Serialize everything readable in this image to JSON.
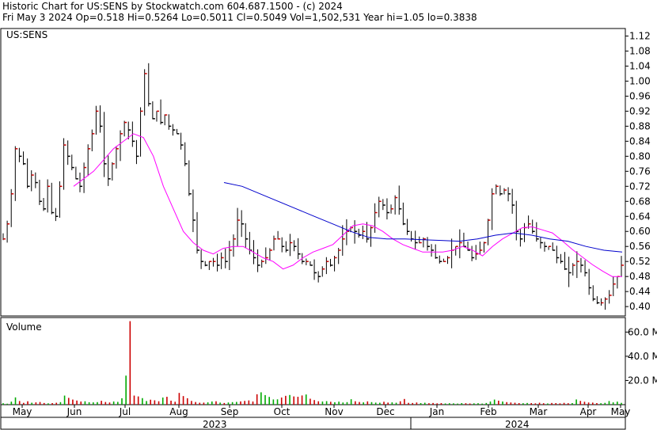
{
  "header": {
    "line1": "Historic Chart for US:SENS by Stockwatch.com 604.687.1500 - (c) 2024",
    "line2": "Fri May  3 2024   Op=0.518   Hi=0.5264   Lo=0.5011   Cl=0.5049   Vol=1,502,531   Year hi=1.05   lo=0.3838"
  },
  "chart_data": [
    {
      "type": "line",
      "title": "US:SENS",
      "series": [
        {
          "name": "",
          "values": [
            0.58,
            0.62,
            0.7,
            0.82,
            0.8,
            0.78,
            0.72,
            0.75,
            0.73,
            0.68,
            0.66,
            0.72,
            0.65,
            0.64,
            0.72,
            0.83,
            0.8,
            0.77,
            0.74,
            0.72,
            0.77,
            0.82,
            0.86,
            0.92,
            0.88,
            0.78,
            0.74,
            0.78,
            0.82,
            0.86,
            0.89,
            0.87,
            0.84,
            0.8,
            0.92,
            1.02,
            0.94,
            0.9,
            0.92,
            0.89,
            0.91,
            0.88,
            0.87,
            0.86,
            0.83,
            0.78,
            0.7,
            0.63,
            0.55,
            0.52,
            0.51,
            0.52,
            0.52,
            0.51,
            0.53,
            0.52,
            0.55,
            0.58,
            0.63,
            0.62,
            0.58,
            0.55,
            0.53,
            0.51,
            0.52,
            0.53,
            0.55,
            0.58,
            0.58,
            0.56,
            0.55,
            0.57,
            0.56,
            0.54,
            0.52,
            0.52,
            0.51,
            0.49,
            0.48,
            0.5,
            0.52,
            0.51,
            0.53,
            0.55,
            0.58,
            0.6,
            0.61,
            0.6,
            0.59,
            0.6,
            0.58,
            0.61,
            0.65,
            0.68,
            0.67,
            0.65,
            0.66,
            0.69,
            0.66,
            0.62,
            0.6,
            0.58,
            0.57,
            0.57,
            0.58,
            0.56,
            0.55,
            0.53,
            0.52,
            0.52,
            0.53,
            0.55,
            0.56,
            0.57,
            0.56,
            0.55,
            0.53,
            0.54,
            0.55,
            0.57,
            0.63,
            0.7,
            0.72,
            0.7,
            0.71,
            0.7,
            0.67,
            0.6,
            0.58,
            0.61,
            0.62,
            0.6,
            0.58,
            0.57,
            0.56,
            0.56,
            0.55,
            0.53,
            0.52,
            0.5,
            0.49,
            0.51,
            0.52,
            0.51,
            0.49,
            0.45,
            0.42,
            0.41,
            0.41,
            0.42,
            0.43,
            0.46,
            0.48,
            0.51
          ]
        },
        {
          "name": "",
          "values": [
            0.72,
            0.74,
            0.76,
            0.79,
            0.82,
            0.84,
            0.86,
            0.85,
            0.8,
            0.72,
            0.66,
            0.6,
            0.57,
            0.55,
            0.54,
            0.555,
            0.56,
            0.56,
            0.545,
            0.53,
            0.52,
            0.5,
            0.51,
            0.53,
            0.545,
            0.555,
            0.565,
            0.59,
            0.615,
            0.62,
            0.615,
            0.6,
            0.58,
            0.565,
            0.555,
            0.545,
            0.545,
            0.545,
            0.55,
            0.56,
            0.55,
            0.535,
            0.56,
            0.58,
            0.595,
            0.61,
            0.612,
            0.604,
            0.596,
            0.575,
            0.552,
            0.532,
            0.512,
            0.495,
            0.48,
            0.48
          ]
        },
        {
          "name": "",
          "values": [
            0.73,
            0.72,
            0.7,
            0.68,
            0.66,
            0.64,
            0.62,
            0.6,
            0.584,
            0.58,
            0.58,
            0.578,
            0.576,
            0.574,
            0.58,
            0.59,
            0.596,
            0.59,
            0.58,
            0.574,
            0.56,
            0.55,
            0.545
          ]
        }
      ],
      "ylim": [
        0.375,
        1.14
      ],
      "y_ticks": [
        "1.12",
        "1.08",
        "1.04",
        "1.00",
        "0.96",
        "0.92",
        "0.88",
        "0.84",
        "0.80",
        "0.76",
        "0.72",
        "0.68",
        "0.64",
        "0.60",
        "0.56",
        "0.52",
        "0.48",
        "0.44",
        "0.40"
      ]
    },
    {
      "type": "bar",
      "title": "Volume",
      "values": [
        1.2,
        0.8,
        2.5,
        6.0,
        3.0,
        1.5,
        2.8,
        1.6,
        1.9,
        2.2,
        1.4,
        1.1,
        1.3,
        1.6,
        2.1,
        7.5,
        5.6,
        4.2,
        3.4,
        2.6,
        2.8,
        2.0,
        1.9,
        2.1,
        3.2,
        2.2,
        1.8,
        2.6,
        2.3,
        5.3,
        24.0,
        69.0,
        7.5,
        6.8,
        5.4,
        3.0,
        4.1,
        3.6,
        2.8,
        5.9,
        6.5,
        3.3,
        2.4,
        9.7,
        7.1,
        5.3,
        3.1,
        2.2,
        1.6,
        1.7,
        1.9,
        2.6,
        2.8,
        1.7,
        1.4,
        1.8,
        2.1,
        2.3,
        2.7,
        3.1,
        3.5,
        2.6,
        8.6,
        10.2,
        7.9,
        6.4,
        4.3,
        4.4,
        5.9,
        7.3,
        8.0,
        6.8,
        6.5,
        7.6,
        8.4,
        4.9,
        3.8,
        2.8,
        2.6,
        2.9,
        2.4,
        2.0,
        2.5,
        1.8,
        2.1,
        4.5,
        2.8,
        2.2,
        1.9,
        2.7,
        2.1,
        1.7,
        1.6,
        2.4,
        1.7,
        1.9,
        1.6,
        2.8,
        4.7,
        1.5,
        1.4,
        1.8,
        1.3,
        1.6,
        1.2,
        1.4,
        1.1,
        1.3,
        1.0,
        1.2,
        1.1,
        0.9,
        1.3,
        1.2,
        1.0,
        1.1,
        1.2,
        0.9,
        1.4,
        2.6,
        4.2,
        3.3,
        2.6,
        2.1,
        1.8,
        1.6,
        1.3,
        1.2,
        1.4,
        1.3,
        1.1,
        1.6,
        1.2,
        1.0,
        1.4,
        1.3,
        1.1,
        1.5,
        1.2,
        1.3,
        4.3,
        3.1,
        2.4,
        1.8,
        1.7,
        1.3,
        1.2,
        1.5,
        3.0,
        1.9,
        2.5,
        1.5
      ],
      "ylim": [
        0,
        72
      ],
      "y_ticks": [
        "60.0 M",
        "40.0 M",
        "20.0 M"
      ]
    }
  ],
  "x_axis": {
    "months": [
      "May",
      "Jun",
      "Jul",
      "Aug",
      "Sep",
      "Oct",
      "Nov",
      "Dec",
      "Jan",
      "Feb",
      "Mar",
      "Apr",
      "May"
    ],
    "years": [
      "2023",
      "2024"
    ]
  },
  "colors": {
    "up": "#cc0000",
    "down": "#000000",
    "ma_short": "#ff00ff",
    "ma_long": "#0000cc",
    "vol_up": "#00aa00",
    "vol_down": "#cc0000"
  }
}
